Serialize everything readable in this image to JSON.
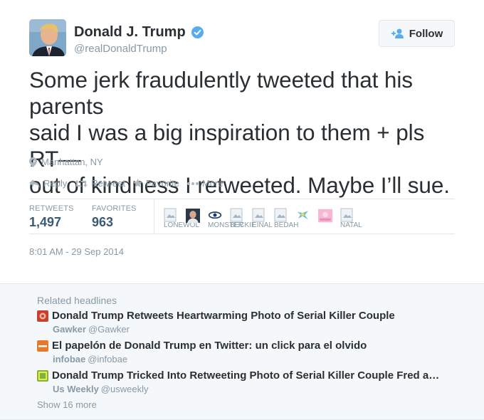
{
  "author": {
    "name": "Donald J. Trump",
    "handle": "@realDonaldTrump",
    "verified": true
  },
  "follow_button": {
    "label": "Follow",
    "icon": "follow-person-icon"
  },
  "tweet": {
    "text_lines": [
      "Some jerk fraudulently tweeted that his parents",
      "said I was a big inspiration to them + pls RT—",
      "out of kindness I retweeted. Maybe I’ll sue."
    ],
    "location": "Manhattan, NY",
    "timestamp": "8:01 AM - 29 Sep 2014"
  },
  "actions": [
    {
      "label": "Reply",
      "icon": "reply-icon"
    },
    {
      "label": "Retweet",
      "icon": "retweet-icon"
    },
    {
      "label": "Favorite",
      "icon": "star-icon"
    },
    {
      "label": "More",
      "icon": "more-dots-icon"
    }
  ],
  "stats": {
    "retweets_label": "RETWEETS",
    "retweets_value": "1,497",
    "favorites_label": "FAVORITES",
    "favorites_value": "963"
  },
  "retweeter_avatars": [
    {
      "label": "LONEWOL"
    },
    {
      "label": ""
    },
    {
      "label": "MONSTER"
    },
    {
      "label": "BECKIE"
    },
    {
      "label": "EINAL"
    },
    {
      "label": "BEDAH"
    },
    {
      "label": ""
    },
    {
      "label": ""
    },
    {
      "label": "NATAL"
    }
  ],
  "related": {
    "title": "Related headlines",
    "headlines": [
      {
        "title": "Donald Trump Retweets Heartwarming Photo of Serial Killer Couple",
        "source": "Gawker",
        "source_handle": "@Gawker",
        "icon_color": "#c8412e"
      },
      {
        "title": "El papelón de Donald Trump en Twitter: un click para el olvido",
        "source": "infobae",
        "source_handle": "@infobae",
        "icon_color": "#e8792b"
      },
      {
        "title": "Donald Trump Tricked Into Retweeting Photo of Serial Killer Couple Fred an…",
        "source": "Us Weekly",
        "source_handle": "@usweekly",
        "icon_color": "#7fb33f"
      }
    ],
    "show_more": "Show 16 more"
  },
  "colors": {
    "text": "#292f33",
    "muted": "#8899a6",
    "verified_blue": "#55acee",
    "stat_blue": "#3b5a73",
    "border": "#e1e8ed",
    "related_bg": "#f5f8fa"
  }
}
